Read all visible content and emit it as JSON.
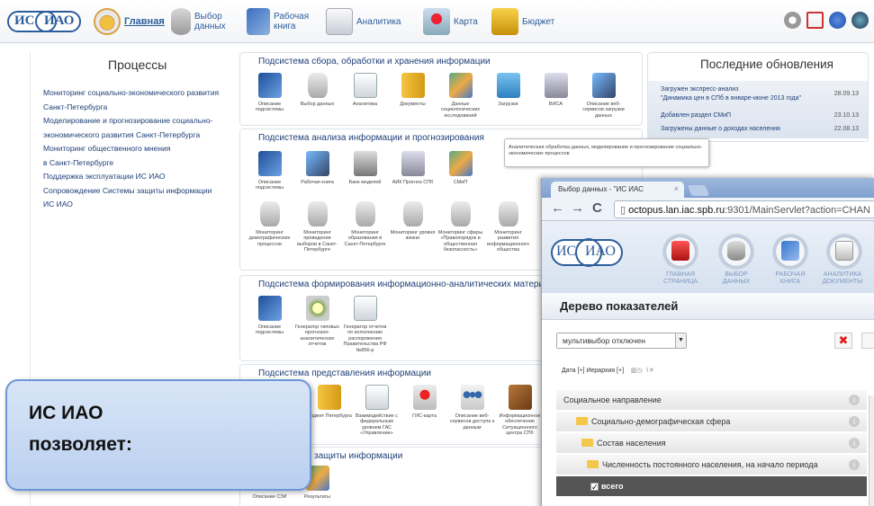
{
  "topbar": {
    "logo_left": "ИС",
    "logo_right": "ИАО",
    "nav": [
      {
        "label": "Главная",
        "icon": "home-icon"
      },
      {
        "label": "Выбор данных",
        "icon": "database-icon"
      },
      {
        "label": "Рабочая книга",
        "icon": "workbook-icon"
      },
      {
        "label": "Аналитика",
        "icon": "analytics-icon"
      },
      {
        "label": "Карта",
        "icon": "map-icon"
      },
      {
        "label": "Бюджет",
        "icon": "budget-icon"
      }
    ],
    "right_icons": [
      "settings-icon",
      "edit-icon",
      "help-icon",
      "account-icon"
    ]
  },
  "processes": {
    "title": "Процессы",
    "items": [
      "Мониторинг социально-экономического развития",
      "Санкт-Петербурга",
      "Моделирование и прогнозирование социально-",
      "экономического развития Санкт-Петербурга",
      "Мониторинг общественного мнения",
      "в Санкт-Петербурге",
      "Поддержка эксплуатации ИС ИАО",
      "Сопровождение Системы защиты информации",
      "ИС ИАО"
    ]
  },
  "subsystems": [
    {
      "title": "Подсистема сбора, обработки и хранения информации",
      "tiles": [
        "Описание подсистемы",
        "Выбор данных",
        "Аналитика",
        "Документы",
        "Данные социологических исследований",
        "Загрузки",
        "ВИСА",
        "Описание веб-сервисов загрузки данных"
      ]
    },
    {
      "title": "Подсистема анализа информации и прогнозирования",
      "tiles": [
        "Описание подсистемы",
        "Рабочая книга",
        "Банк моделей",
        "АИК Прогноз СПб",
        "СМиП"
      ],
      "tiles2": [
        "Мониторинг демографических процессов",
        "Мониторинг проведения выборов в Санкт-Петербурге",
        "Мониторинг образования в Санкт-Петербурге",
        "Мониторинг уровня жизни",
        "Мониторинг сферы «Правопорядок и общественная безопасность»",
        "Мониторинг развития информационного общества"
      ]
    },
    {
      "title": "Подсистема формирования информационно-аналитических матери",
      "tiles": [
        "Описание подсистемы",
        "Генератор типовых прогнозно-аналитических отчетов",
        "Генератор отчетов по исполнению распоряжения Правительства РФ №856-р"
      ]
    },
    {
      "title": "Подсистема представления информации",
      "tiles": [
        "Бюджет Петербурга",
        "Взаимодействие с федеральным уровнем ГАС «Управление»",
        "ГИС-карта",
        "Описание веб-сервисов доступа к данным",
        "Информационное обеспечение Ситуационного центра СПб"
      ]
    },
    {
      "title": "защиты информации",
      "tiles": [
        "Описание СЗИ",
        "Результаты"
      ]
    }
  ],
  "tooltip": "Аналитическая обработка данных, моделирование и прогнозирование социально-экономических процессов",
  "updates": {
    "title": "Последние обновления",
    "items": [
      {
        "text": "Загружен экспресс-анализ",
        "text2": "\"Динамика цен в СПб в январе-июне 2013 года\"",
        "date": "28.09.13"
      },
      {
        "text": "Добавлен раздел СМиП",
        "date": "23.10.13"
      },
      {
        "text": "Загружены данные о доходах населения",
        "date": "22.08.13"
      }
    ]
  },
  "browser": {
    "tab_title": "Выбор данных - \"ИС ИАС",
    "url_host": "octopus.lan.iac.spb.ru",
    "url_rest": ":9301/MainServlet?action=CHAN",
    "logo_left": "ИС",
    "logo_right": "ИАО",
    "nav": [
      {
        "cap": "ГЛАВНАЯ СТРАНИЦА"
      },
      {
        "cap": "ВЫБОР ДАННЫХ"
      },
      {
        "cap": "РАБОЧАЯ КНИГА"
      },
      {
        "cap": "АНАЛИТИКА ДОКУМЕНТЫ"
      }
    ],
    "tree_title": "Дерево показателей",
    "multiselect": "мультивыбор отключен",
    "filter": "Дата [+] Иерархия [+]",
    "rows": [
      "Социальное направление",
      "Социально-демографическая сфера",
      "Состав населения",
      "Численность постоянного населения, на начало периода",
      "всего"
    ]
  },
  "callout": {
    "line1": "ИС ИАО",
    "line2": "позволяет:"
  }
}
